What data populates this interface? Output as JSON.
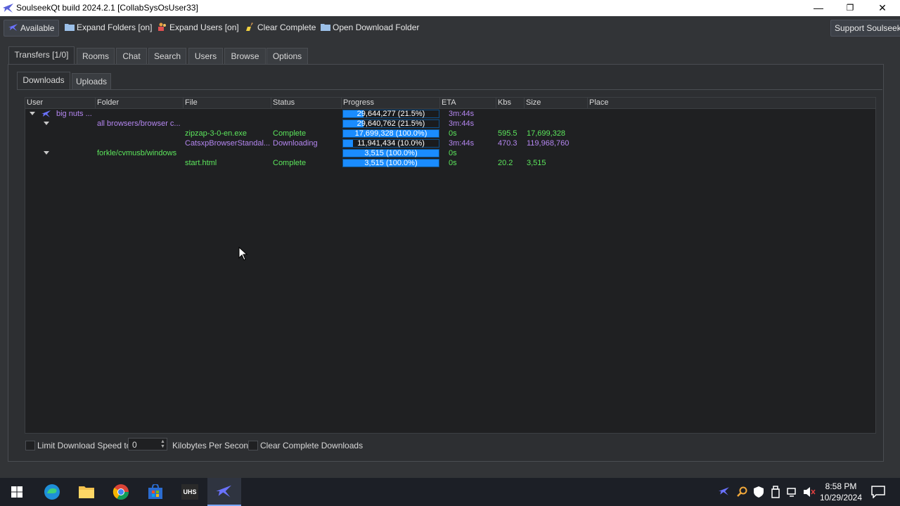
{
  "window": {
    "title": "SoulseekQt build 2024.2.1 [CollabSysOsUser33]",
    "controls": {
      "minimize": "—",
      "restore": "❐",
      "close": "✕"
    }
  },
  "toolbar": {
    "status": "Available",
    "expand_folders": "Expand Folders [on]",
    "expand_users": "Expand Users [on]",
    "clear_complete": "Clear Complete",
    "open_download_folder": "Open Download Folder",
    "support": "Support Soulseek!"
  },
  "tabs": [
    "Transfers [1/0]",
    "Rooms",
    "Chat",
    "Search",
    "Users",
    "Browse",
    "Options"
  ],
  "subtabs": [
    "Downloads",
    "Uploads"
  ],
  "columns": [
    "User",
    "Folder",
    "File",
    "Status",
    "Progress",
    "ETA",
    "Kbs",
    "Size",
    "Place"
  ],
  "rows": [
    {
      "user": "big nuts ...",
      "folder": "",
      "file": "",
      "status": "",
      "progress_text": "29,644,277 (21.5%)",
      "progress": 0.215,
      "eta": "3m:44s",
      "kbs": "",
      "size": "",
      "place": ""
    },
    {
      "user": "",
      "folder": "all browsers/browser c...",
      "file": "",
      "status": "",
      "progress_text": "29,640,762 (21.5%)",
      "progress": 0.215,
      "eta": "3m:44s",
      "kbs": "",
      "size": "",
      "place": ""
    },
    {
      "user": "",
      "folder": "",
      "file": "zipzap-3-0-en.exe",
      "status": "Complete",
      "progress_text": "17,699,328 (100.0%)",
      "progress": 1.0,
      "eta": "0s",
      "kbs": "595.5",
      "size": "17,699,328",
      "place": ""
    },
    {
      "user": "",
      "folder": "",
      "file": "CatsxpBrowserStandal...",
      "status": "Downloading",
      "progress_text": "11,941,434 (10.0%)",
      "progress": 0.1,
      "eta": "3m:44s",
      "kbs": "470.3",
      "size": "119,968,760",
      "place": ""
    },
    {
      "user": "",
      "folder": "forkle/cvmusb/windows",
      "file": "",
      "status": "",
      "progress_text": "3,515 (100.0%)",
      "progress": 1.0,
      "eta": "0s",
      "kbs": "",
      "size": "",
      "place": ""
    },
    {
      "user": "",
      "folder": "",
      "file": "start.html",
      "status": "Complete",
      "progress_text": "3,515 (100.0%)",
      "progress": 1.0,
      "eta": "0s",
      "kbs": "20.2",
      "size": "3,515",
      "place": ""
    }
  ],
  "bottom": {
    "limit_label": "Limit Download Speed to",
    "limit_value": "0",
    "unit": "Kilobytes Per Second",
    "clear_label": "Clear Complete Downloads"
  },
  "taskbar": {
    "apps": [
      "windows-start",
      "edge",
      "file-explorer",
      "chrome",
      "store",
      "uhs",
      "soulseek"
    ],
    "uhs_label": "UHS",
    "time": "8:58 PM",
    "date": "10/29/2024"
  },
  "colors": {
    "purple": "#b486f0",
    "green": "#5ce65c",
    "progress": "#1a8cff"
  }
}
